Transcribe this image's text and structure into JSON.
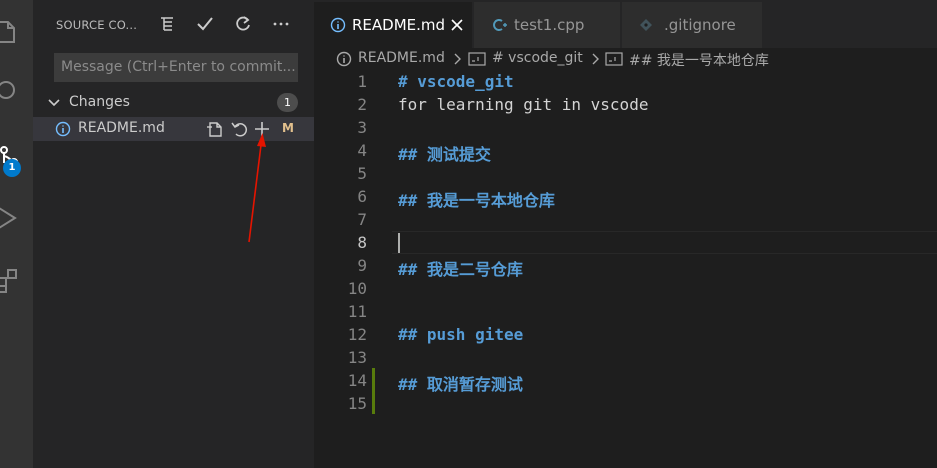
{
  "sidebar": {
    "title": "SOURCE CO...",
    "message_placeholder": "Message (Ctrl+Enter to commit...",
    "changes_label": "Changes",
    "changes_count": "1",
    "file": {
      "name": "README.md",
      "status": "M"
    }
  },
  "activity": {
    "scm_badge": "1"
  },
  "tabs": [
    {
      "label": "README.md",
      "icon": "info-icon"
    },
    {
      "label": "test1.cpp",
      "icon": "cpp-icon"
    },
    {
      "label": ".gitignore",
      "icon": "git-icon"
    }
  ],
  "breadcrumb": {
    "file": "README.md",
    "section1": "# vscode_git",
    "section2": "## 我是一号本地仓库"
  },
  "editor": {
    "lines": [
      {
        "num": "1",
        "text": "# vscode_git",
        "kind": "heading"
      },
      {
        "num": "2",
        "text": "for learning git in vscode",
        "kind": "plain"
      },
      {
        "num": "3",
        "text": "",
        "kind": "plain"
      },
      {
        "num": "4",
        "text": "## 测试提交",
        "kind": "heading"
      },
      {
        "num": "5",
        "text": "",
        "kind": "plain"
      },
      {
        "num": "6",
        "text": "## 我是一号本地仓库",
        "kind": "heading"
      },
      {
        "num": "7",
        "text": "",
        "kind": "plain"
      },
      {
        "num": "8",
        "text": "",
        "kind": "plain"
      },
      {
        "num": "9",
        "text": "## 我是二号仓库",
        "kind": "heading"
      },
      {
        "num": "10",
        "text": "",
        "kind": "plain"
      },
      {
        "num": "11",
        "text": "",
        "kind": "plain"
      },
      {
        "num": "12",
        "text": "## push gitee",
        "kind": "heading"
      },
      {
        "num": "13",
        "text": "",
        "kind": "plain"
      },
      {
        "num": "14",
        "text": "## 取消暂存测试",
        "kind": "heading"
      },
      {
        "num": "15",
        "text": "",
        "kind": "plain"
      }
    ]
  },
  "colors": {
    "accent": "#007acc",
    "heading": "#569cd6",
    "modified": "#e2c08d",
    "arrow": "#e51400",
    "gutter_added": "#587c0c"
  }
}
